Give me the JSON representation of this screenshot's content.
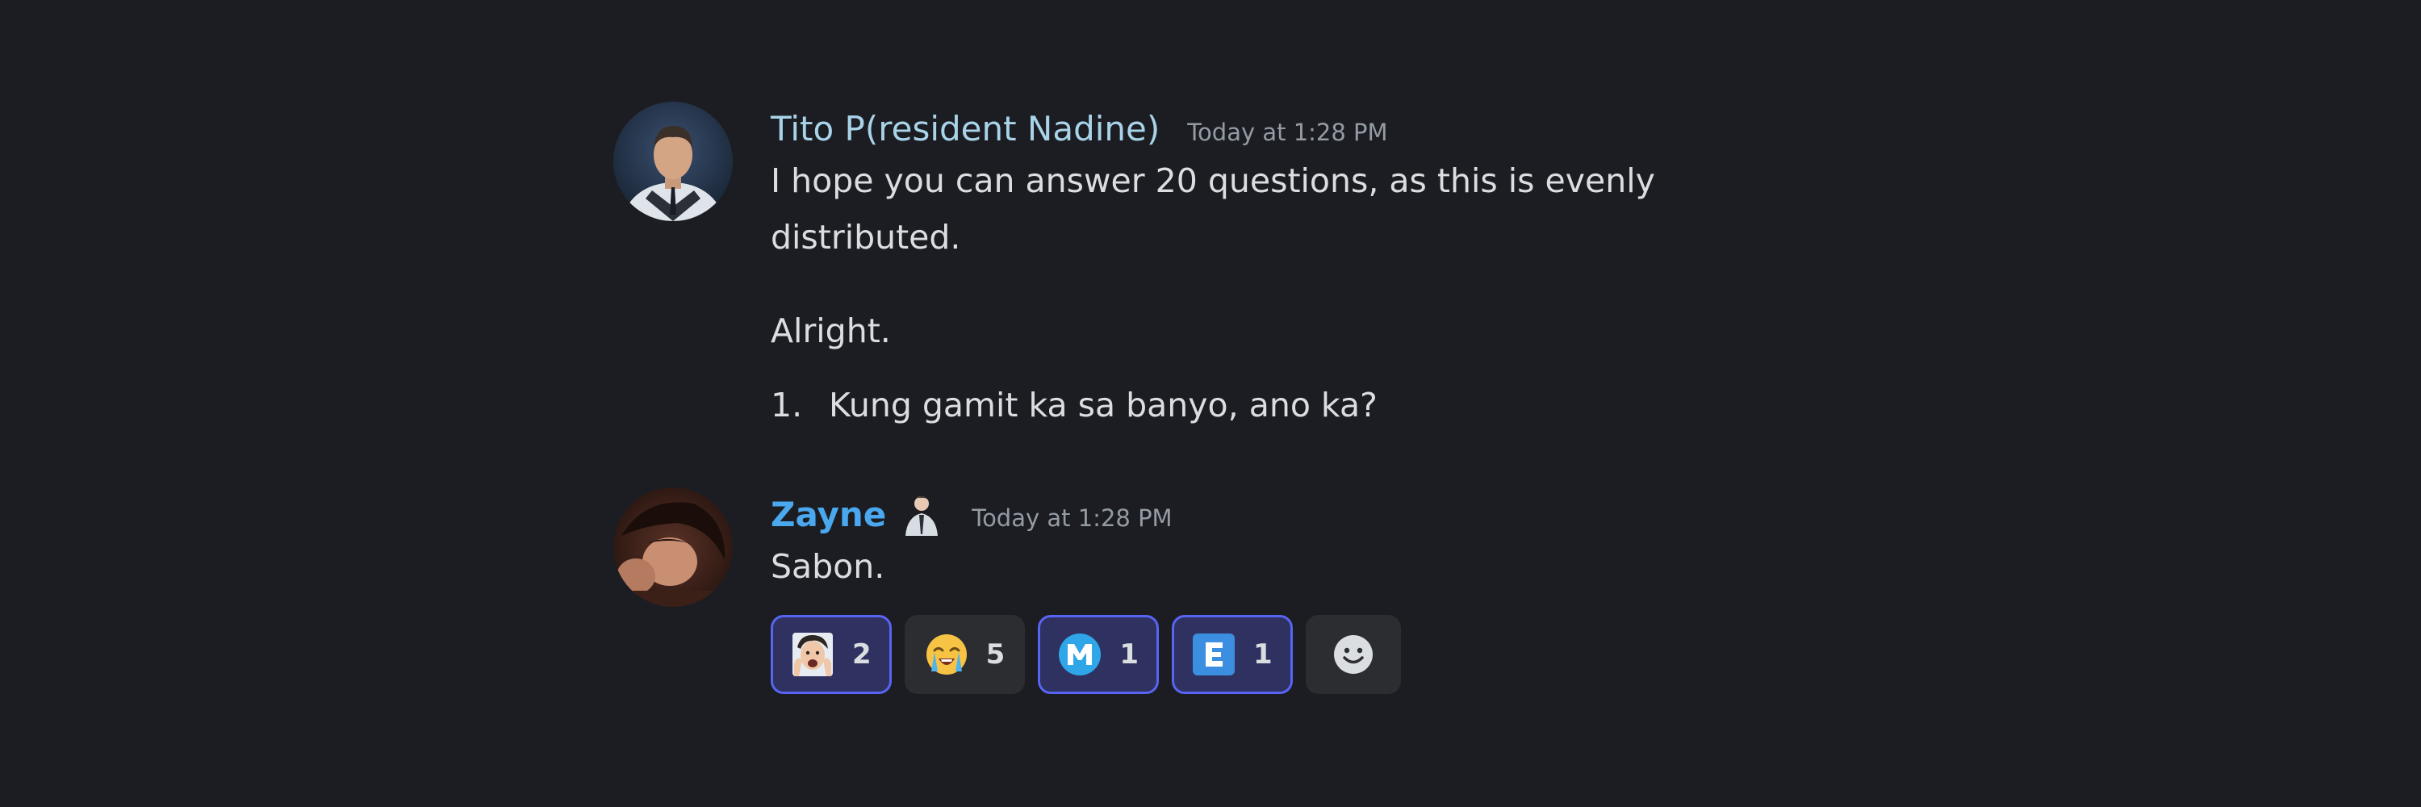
{
  "messages": [
    {
      "username": "Tito P(resident Nadine)",
      "username_color": "#a8d3e8",
      "timestamp": "Today at 1:28 PM",
      "lines": [
        "I hope you can answer 20 questions, as this is evenly",
        "distributed.",
        "Alright."
      ],
      "list": [
        {
          "number": "1.",
          "text": "Kung gamit ka sa banyo, ano ka?"
        }
      ]
    },
    {
      "username": "Zayne",
      "username_color": "#4aa8ee",
      "badge_icon": "person-figure-icon",
      "timestamp": "Today at 1:28 PM",
      "lines": [
        "Sabon."
      ],
      "reactions": [
        {
          "emoji": "face-sticker-emoji",
          "count": "2",
          "selected": true
        },
        {
          "emoji": "loudly-crying-face-emoji",
          "count": "5",
          "selected": false
        },
        {
          "emoji": "letter-m-emoji",
          "count": "1",
          "selected": true
        },
        {
          "emoji": "letter-e-emoji",
          "count": "1",
          "selected": true
        }
      ],
      "add_reaction_icon": "add-reaction-smiley-icon"
    }
  ],
  "colors": {
    "background": "#1c1d22",
    "text": "#dbdee1",
    "timestamp": "#949ba4",
    "reaction_bg": "#2b2d31",
    "reaction_selected_bg": "#2f3160",
    "reaction_selected_border": "#5865f2"
  }
}
